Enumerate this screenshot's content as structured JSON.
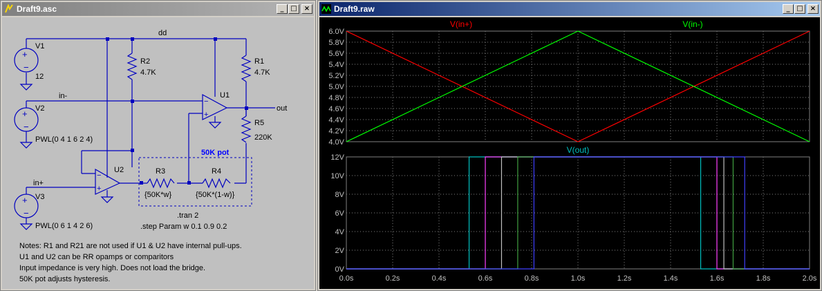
{
  "schematic_window": {
    "title": "Draft9.asc",
    "buttons": {
      "minimize": "_",
      "maximize": "□",
      "close": "×"
    },
    "net_labels": {
      "dd": "dd",
      "in_minus": "in-",
      "in_plus": "in+",
      "out": "out"
    },
    "components": {
      "v1_name": "V1",
      "v1_value": "12",
      "v2_name": "V2",
      "v2_value": "PWL(0 4 1 6 2 4)",
      "v3_name": "V3",
      "v3_value": "PWL(0 6 1 4 2 6)",
      "r1_name": "R1",
      "r1_value": "4.7K",
      "r2_name": "R2",
      "r2_value": "4.7K",
      "r3_name": "R3",
      "r3_value": "{50K*w}",
      "r4_name": "R4",
      "r4_value": "{50K*(1-w)}",
      "r5_name": "R5",
      "r5_value": "220K",
      "u1_name": "U1",
      "u2_name": "U2",
      "pot_label": "50K pot"
    },
    "directives": {
      "tran": ".tran 2",
      "step": ".step Param w 0.1 0.9 0.2"
    },
    "notes": [
      "Notes: R1 and R21 are not used if U1 & U2 have internal pull-ups.",
      "U1 and U2 can be RR opamps or comparitors",
      "Input impedance is very high. Does not load the bridge.",
      "50K pot adjusts hysteresis."
    ]
  },
  "waveform_window": {
    "title": "Draft9.raw",
    "buttons": {
      "minimize": "_",
      "maximize": "□",
      "close": "×"
    },
    "colors": {
      "vin_plus": "#ff0000",
      "vin_minus": "#00ff00",
      "vout": "#00c0c0",
      "grid": "#808080",
      "axis_text": "#c0c0c0"
    },
    "chart_data": [
      {
        "type": "line",
        "series": [
          {
            "name": "V(in+)",
            "x": [
              0,
              1,
              2
            ],
            "y": [
              6.0,
              4.0,
              6.0
            ]
          },
          {
            "name": "V(in-)",
            "x": [
              0,
              1,
              2
            ],
            "y": [
              4.0,
              6.0,
              4.0
            ]
          }
        ],
        "ylim": [
          4.0,
          6.0
        ],
        "xlim": [
          0,
          2
        ],
        "y_ticks": [
          "6.0V",
          "5.8V",
          "5.6V",
          "5.4V",
          "5.2V",
          "5.0V",
          "4.8V",
          "4.6V",
          "4.4V",
          "4.2V",
          "4.0V"
        ],
        "grid": true
      },
      {
        "type": "line",
        "series": [
          {
            "name": "V(out)",
            "color": "#00c0c0",
            "x": [
              0,
              0.53,
              0.53,
              1.53,
              1.53,
              2
            ],
            "y": [
              0,
              0,
              12,
              12,
              0,
              0
            ]
          },
          {
            "color": "#ff40ff",
            "x": [
              0,
              0.6,
              0.6,
              1.6,
              1.6,
              2
            ],
            "y": [
              0,
              0,
              12,
              12,
              0,
              0
            ]
          },
          {
            "color": "#c0c0c0",
            "x": [
              0,
              0.67,
              0.67,
              1.63,
              1.63,
              2
            ],
            "y": [
              0,
              0,
              12,
              12,
              0,
              0
            ]
          },
          {
            "color": "#40a040",
            "x": [
              0,
              0.74,
              0.74,
              1.67,
              1.67,
              2
            ],
            "y": [
              0,
              0,
              12,
              12,
              0,
              0
            ]
          },
          {
            "color": "#4040ff",
            "x": [
              0,
              0.81,
              0.81,
              1.72,
              1.72,
              2
            ],
            "y": [
              0,
              0,
              12,
              12,
              0,
              0
            ]
          }
        ],
        "ylim": [
          0,
          12
        ],
        "xlim": [
          0,
          2
        ],
        "y_ticks": [
          "12V",
          "10V",
          "8V",
          "6V",
          "4V",
          "2V",
          "0V"
        ],
        "x_ticks": [
          "0.0s",
          "0.2s",
          "0.4s",
          "0.6s",
          "0.8s",
          "1.0s",
          "1.2s",
          "1.4s",
          "1.6s",
          "1.8s",
          "2.0s"
        ],
        "grid": true
      }
    ]
  }
}
